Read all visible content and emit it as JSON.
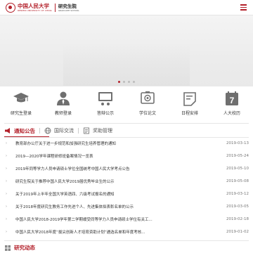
{
  "header": {
    "university": "中国人民大学",
    "university_en": "RENMIN UNIVERSITY OF CHINA",
    "school": "研究生院",
    "school_en": "GRADUATE SCHOOL"
  },
  "quick_links": [
    {
      "label": "研究生登录",
      "icon": "graduation-cap-icon"
    },
    {
      "label": "教师登录",
      "icon": "teacher-icon"
    },
    {
      "label": "答辩公示",
      "icon": "defense-icon"
    },
    {
      "label": "学位论文",
      "icon": "thesis-icon"
    },
    {
      "label": "日程安排",
      "icon": "schedule-icon"
    },
    {
      "label": "人大校历",
      "icon": "calendar-icon"
    }
  ],
  "calendar_day": "7",
  "tabs": [
    {
      "label": "通知公告",
      "active": true
    },
    {
      "label": "国际交流",
      "active": false
    },
    {
      "label": "奖助管理",
      "active": false
    }
  ],
  "news": [
    {
      "title": "教育部办公厅关于进一步规范和加强研究生培养管理的通知",
      "date": "2019-03-13"
    },
    {
      "title": "2019—2020学年课程研修班备案情况一览表",
      "date": "2019-05-24"
    },
    {
      "title": "2019年同等学力人员申请硕士学位全国统考中国人民大学考点公告",
      "date": "2019-05-10"
    },
    {
      "title": "研究生院关于推荐中国人民大学2019届优秀毕业生的公示",
      "date": "2019-05-08"
    },
    {
      "title": "关于2019年上半年全国大学英语四、六级考试报名的通知",
      "date": "2019-03-12"
    },
    {
      "title": "关于2018年度研究生教务工作先进个人、先进集体拟表彰名单的公示",
      "date": "2019-03-05"
    },
    {
      "title": "中国人民大学2018-2019学年第二学期缓受同等学力人员申请硕士学位有关工...",
      "date": "2019-02-18"
    },
    {
      "title": "中国人民大学2018年度“拔尖创新人才培育资助计划”遴选名单和年度考核...",
      "date": "2019-01-02"
    }
  ],
  "section2_title": "研究动态",
  "colors": {
    "accent": "#b3202a",
    "icon": "#6f6f6f"
  }
}
